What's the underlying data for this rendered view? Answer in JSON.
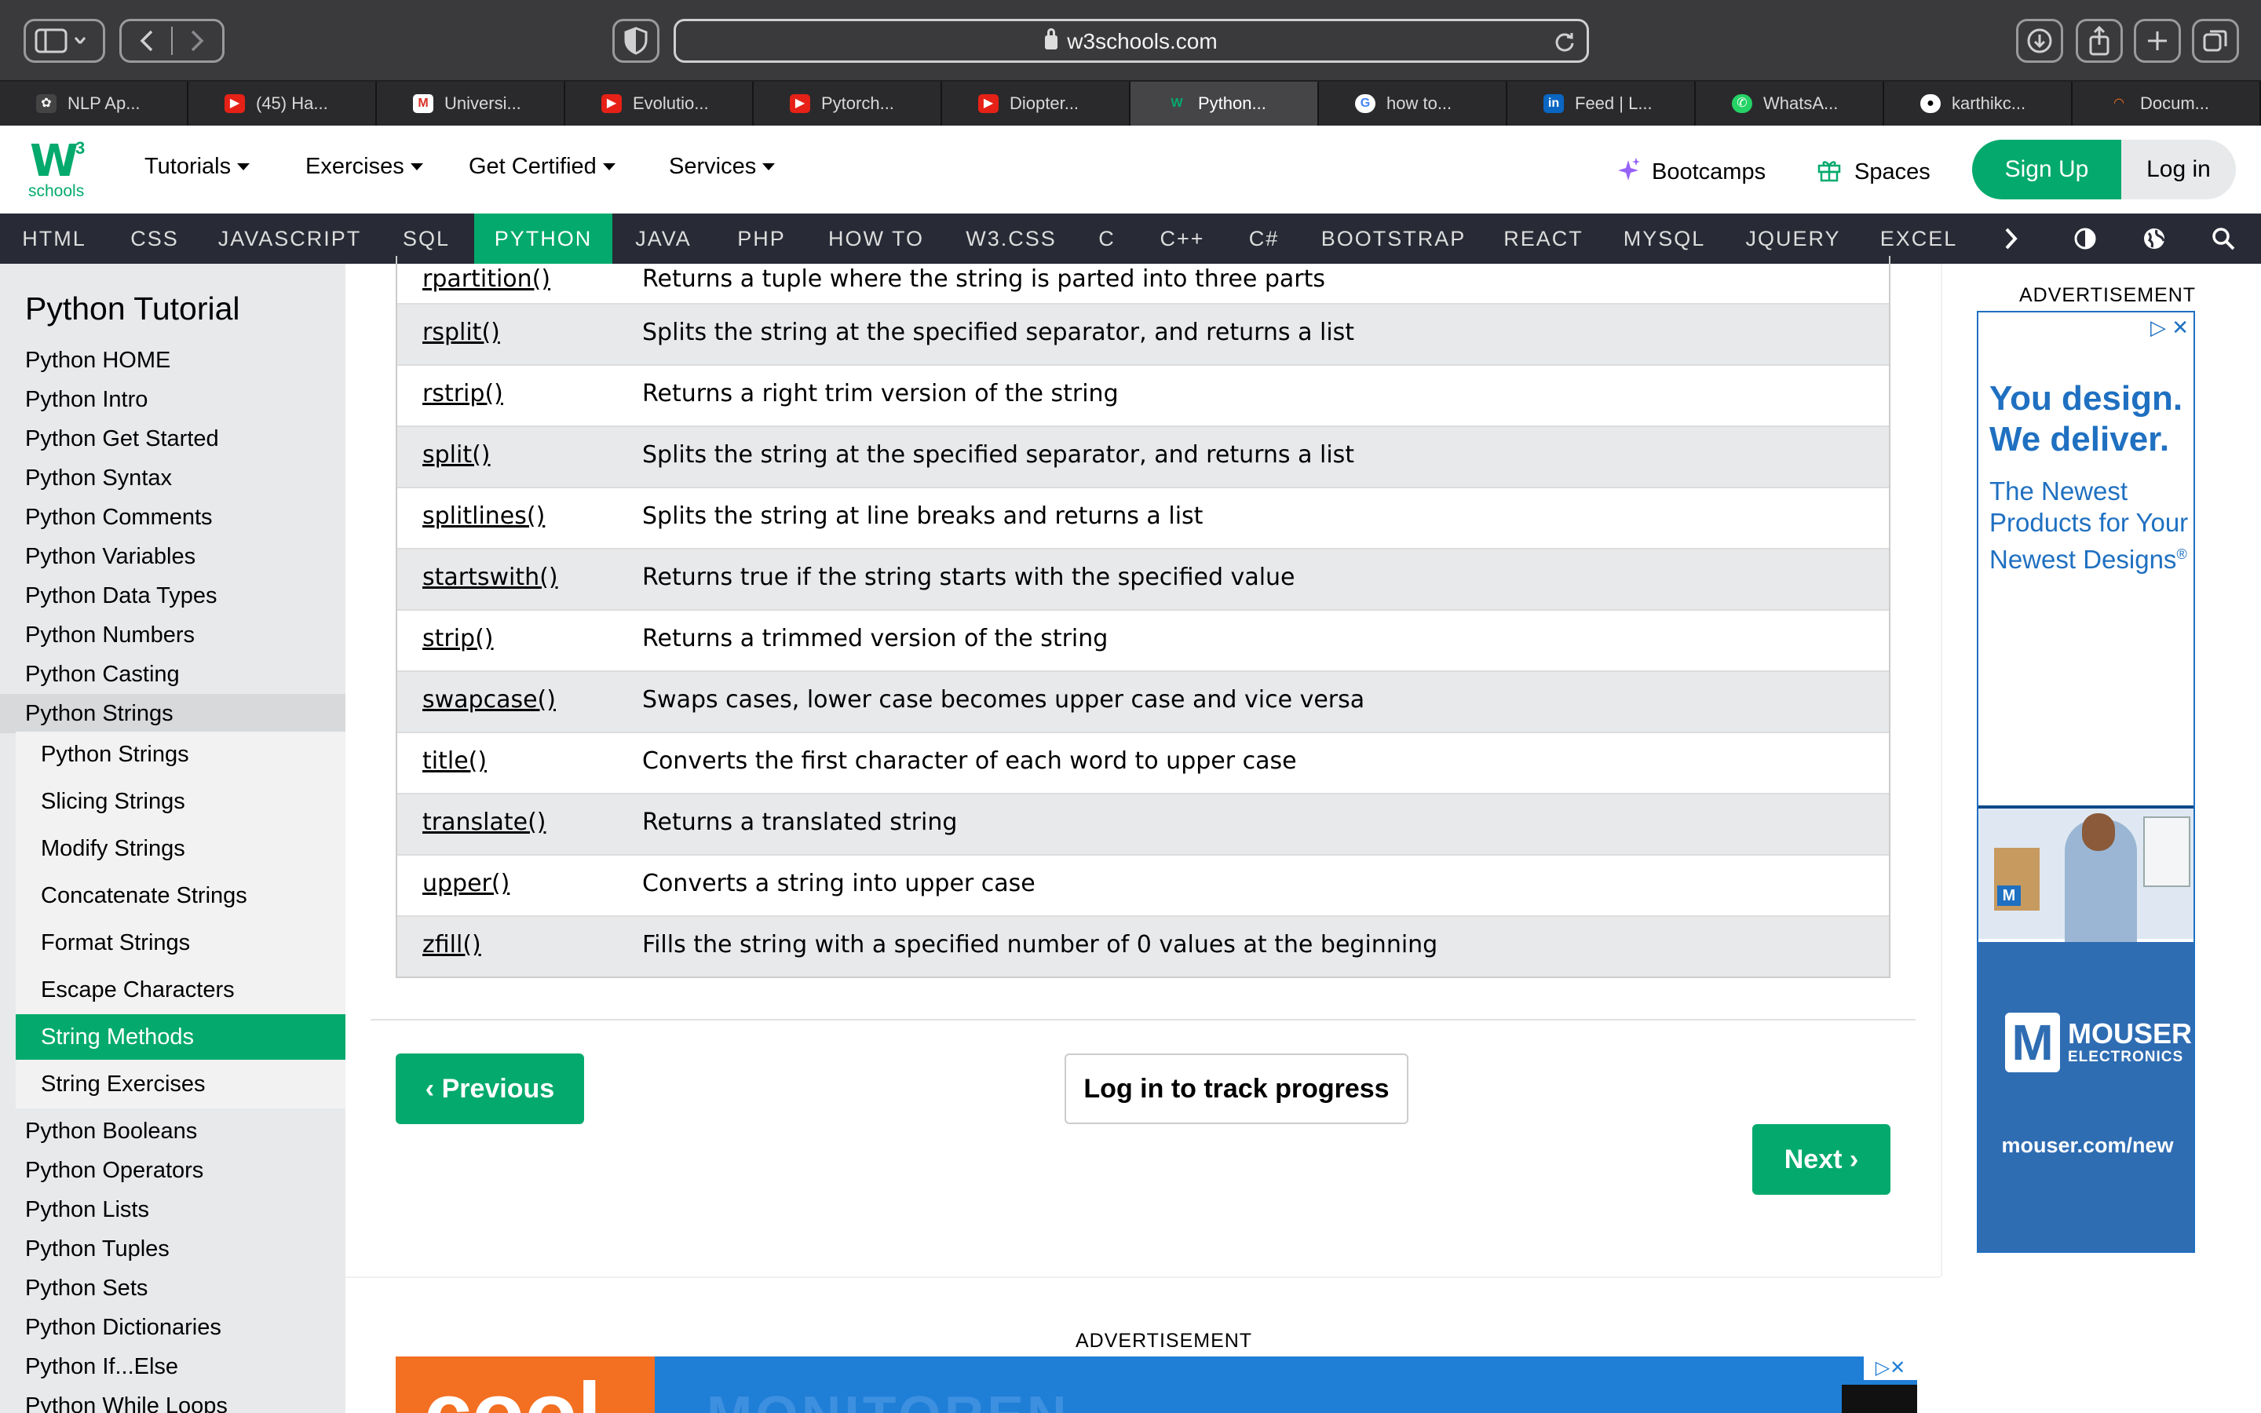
{
  "browser": {
    "url": "w3schools.com",
    "tabs": [
      {
        "label": "NLP Ap...",
        "icon": "openai-icon",
        "color": "#3d3d3d"
      },
      {
        "label": "(45) Ha...",
        "icon": "youtube-icon",
        "color": "#e62117"
      },
      {
        "label": "Universi...",
        "icon": "gmail-icon",
        "color": "#ffffff"
      },
      {
        "label": "Evolutio...",
        "icon": "youtube-icon",
        "color": "#e62117"
      },
      {
        "label": "Pytorch...",
        "icon": "youtube-icon",
        "color": "#e62117"
      },
      {
        "label": "Diopter...",
        "icon": "youtube-icon",
        "color": "#e62117"
      },
      {
        "label": "Python...",
        "icon": "w3schools-icon",
        "color": "#04aa6d"
      },
      {
        "label": "how to...",
        "icon": "google-icon",
        "color": "#ffffff"
      },
      {
        "label": "Feed | L...",
        "icon": "linkedin-icon",
        "color": "#0a66c2"
      },
      {
        "label": "WhatsA...",
        "icon": "whatsapp-icon",
        "color": "#25d366"
      },
      {
        "label": "karthikc...",
        "icon": "github-icon",
        "color": "#ffffff"
      },
      {
        "label": "Docum...",
        "icon": "document-icon",
        "color": "#f26a1b"
      }
    ]
  },
  "topnav": {
    "logo_w": "W",
    "logo_3": "3",
    "logo_sub": "schools",
    "tutorials": "Tutorials",
    "exercises": "Exercises",
    "certified": "Get Certified",
    "services": "Services",
    "bootcamps": "Bootcamps",
    "spaces": "Spaces",
    "signup": "Sign Up",
    "login": "Log in"
  },
  "subjects": [
    "HTML",
    "CSS",
    "JAVASCRIPT",
    "SQL",
    "PYTHON",
    "JAVA",
    "PHP",
    "HOW TO",
    "W3.CSS",
    "C",
    "C++",
    "C#",
    "BOOTSTRAP",
    "REACT",
    "MYSQL",
    "JQUERY",
    "EXCEL"
  ],
  "sidebar": {
    "title": "Python Tutorial",
    "items_top": [
      "Python HOME",
      "Python Intro",
      "Python Get Started",
      "Python Syntax",
      "Python Comments",
      "Python Variables",
      "Python Data Types",
      "Python Numbers",
      "Python Casting",
      "Python Strings"
    ],
    "sub_items": [
      "Python Strings",
      "Slicing Strings",
      "Modify Strings",
      "Concatenate Strings",
      "Format Strings",
      "Escape Characters",
      "String Methods",
      "String Exercises"
    ],
    "items_bottom": [
      "Python Booleans",
      "Python Operators",
      "Python Lists",
      "Python Tuples",
      "Python Sets",
      "Python Dictionaries",
      "Python If...Else",
      "Python While Loops"
    ]
  },
  "methods": [
    {
      "name": "rpartition()",
      "desc": "Returns a tuple where the string is parted into three parts"
    },
    {
      "name": "rsplit()",
      "desc": "Splits the string at the specified separator, and returns a list"
    },
    {
      "name": "rstrip()",
      "desc": "Returns a right trim version of the string"
    },
    {
      "name": "split()",
      "desc": "Splits the string at the specified separator, and returns a list"
    },
    {
      "name": "splitlines()",
      "desc": "Splits the string at line breaks and returns a list"
    },
    {
      "name": "startswith()",
      "desc": "Returns true if the string starts with the specified value"
    },
    {
      "name": "strip()",
      "desc": "Returns a trimmed version of the string"
    },
    {
      "name": "swapcase()",
      "desc": "Swaps cases, lower case becomes upper case and vice versa"
    },
    {
      "name": "title()",
      "desc": "Converts the first character of each word to upper case"
    },
    {
      "name": "translate()",
      "desc": "Returns a translated string"
    },
    {
      "name": "upper()",
      "desc": "Converts a string into upper case"
    },
    {
      "name": "zfill()",
      "desc": "Fills the string with a specified number of 0 values at the beginning"
    }
  ],
  "nav_buttons": {
    "previous": "Previous",
    "track": "Log in to track progress",
    "next": "Next"
  },
  "ads": {
    "label": "ADVERTISEMENT",
    "right_headline": "You design. We deliver.",
    "right_sub": "The Newest Products for Your Newest Designs",
    "right_reg": "®",
    "right_brand": "MOUSER",
    "right_brand_sub": "ELECTRONICS",
    "right_url": "mouser.com/new",
    "right_photo_tag": "M",
    "right_logo_letter": "M",
    "bottom_label": "ADVERTISEMENT",
    "bottom_big": "cool",
    "bottom_mid": "MONITOREN"
  },
  "colors": {
    "accent": "#04aa6d",
    "subject_bar": "#282a35",
    "sidebar_bg": "#e7e9eb"
  }
}
